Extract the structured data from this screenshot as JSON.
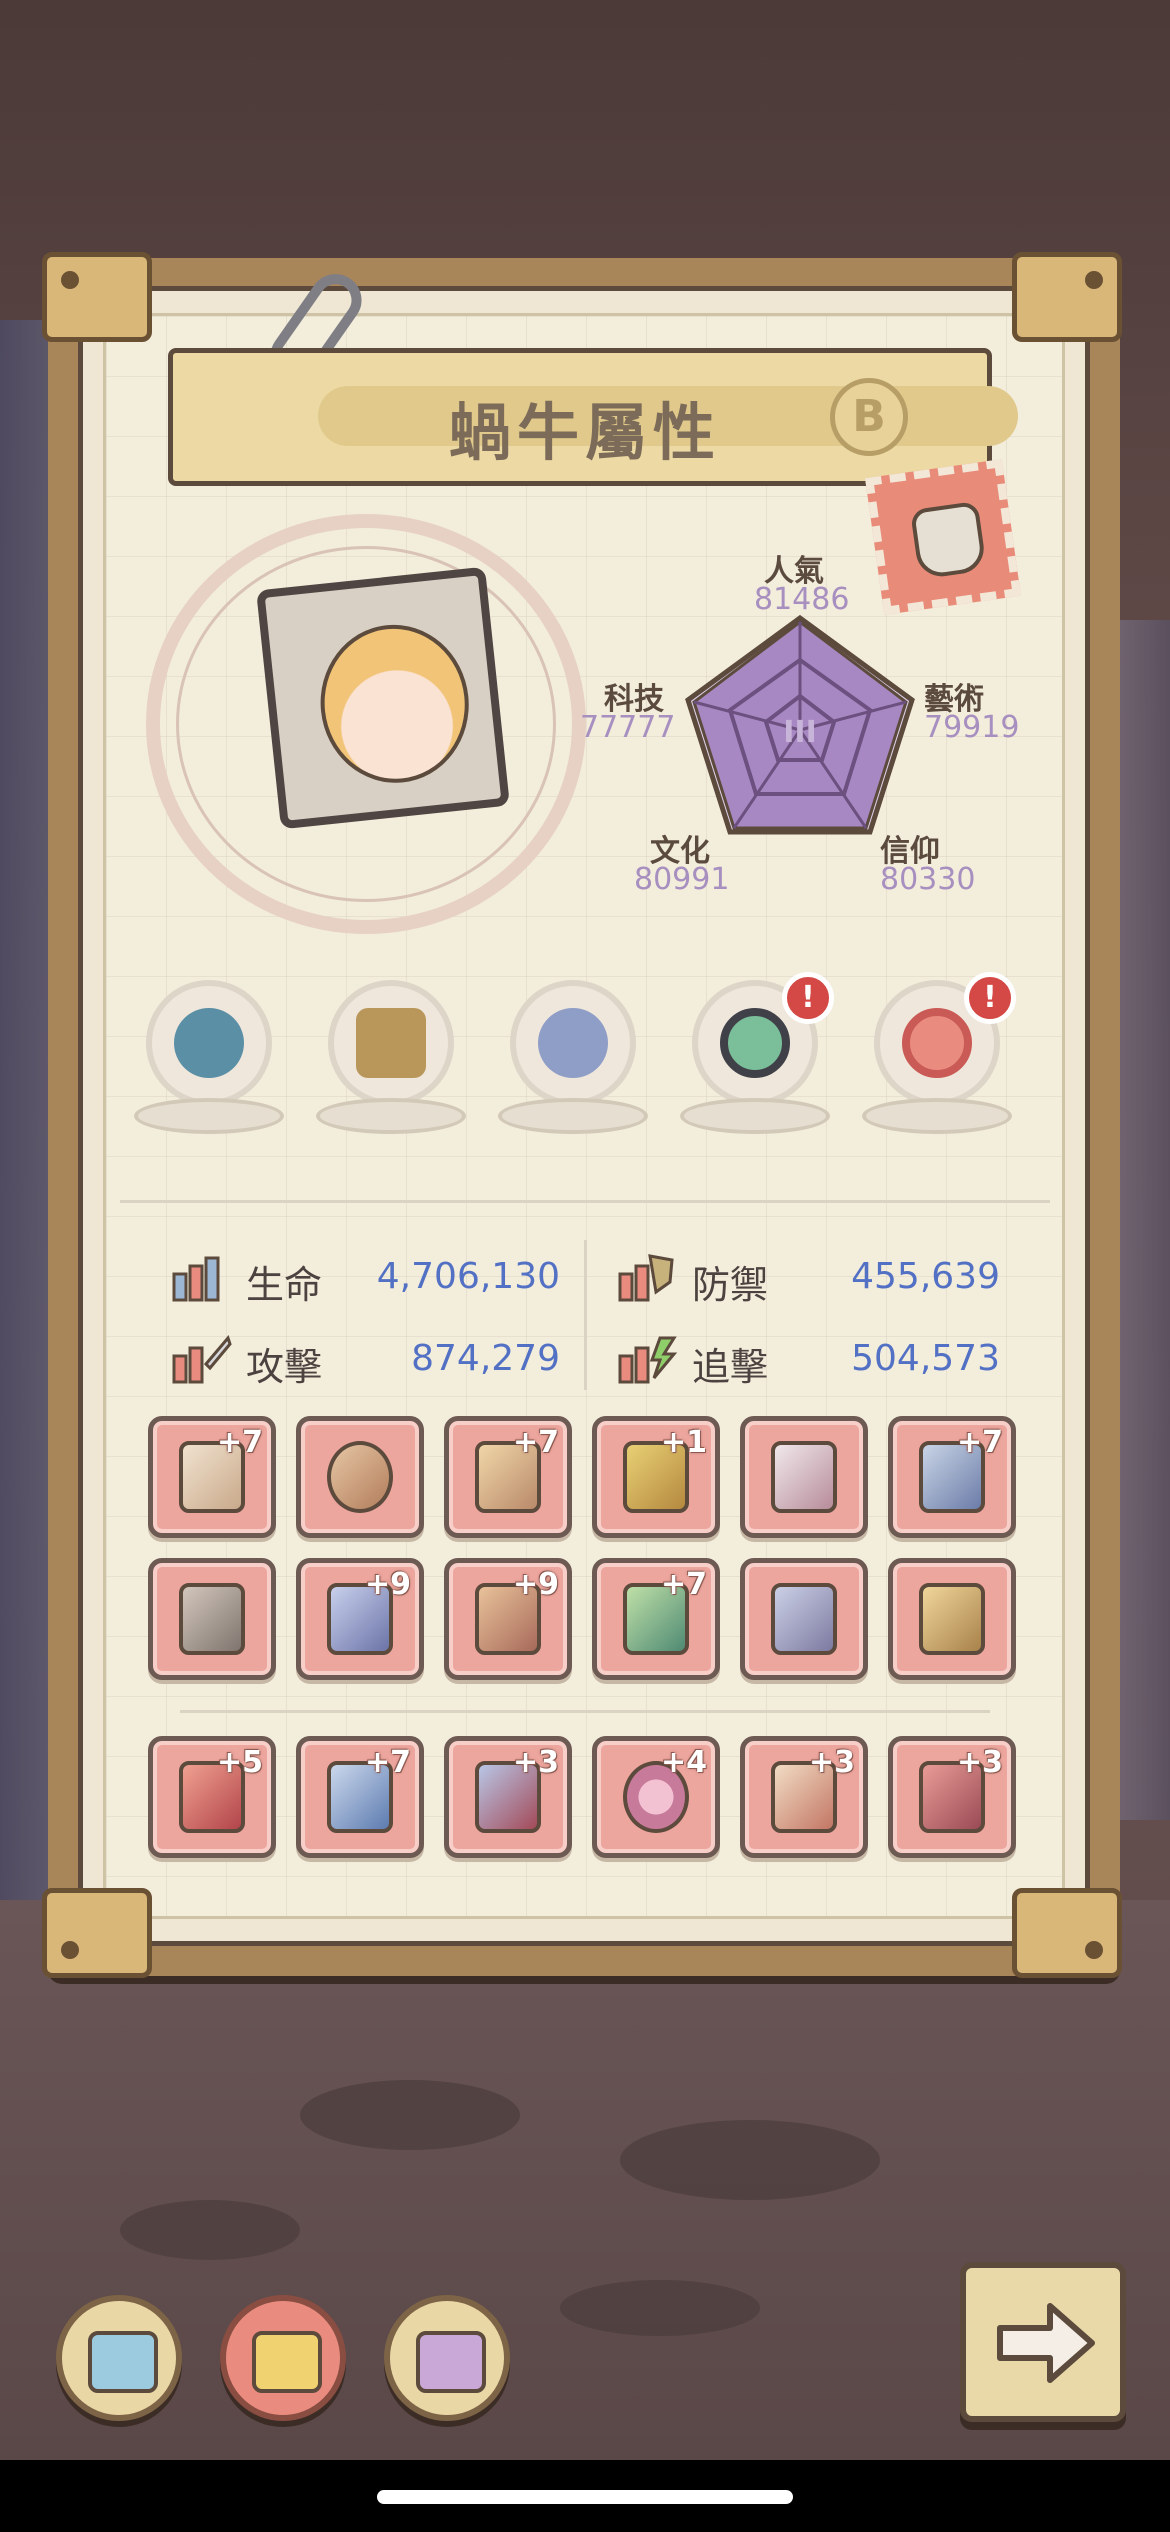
{
  "title": "蝸牛屬性",
  "rank": "B",
  "radar": {
    "center_label": "III",
    "stats": [
      {
        "name": "人氣",
        "value": "81486"
      },
      {
        "name": "藝術",
        "value": "79919"
      },
      {
        "name": "信仰",
        "value": "80330"
      },
      {
        "name": "文化",
        "value": "80991"
      },
      {
        "name": "科技",
        "value": "77777"
      }
    ]
  },
  "relics": [
    {
      "icon": "fish-skeleton-icon",
      "alert": ""
    },
    {
      "icon": "treasure-chest-icon",
      "alert": ""
    },
    {
      "icon": "compass-icon",
      "alert": ""
    },
    {
      "icon": "green-swirl-orb-icon",
      "alert": "!"
    },
    {
      "icon": "red-swirl-orb-icon",
      "alert": "!"
    }
  ],
  "combat": {
    "hp": {
      "label": "生命",
      "value": "4,706,130"
    },
    "def": {
      "label": "防禦",
      "value": "455,639"
    },
    "atk": {
      "label": "攻擊",
      "value": "874,279"
    },
    "chase": {
      "label": "追擊",
      "value": "504,573"
    }
  },
  "equipment": {
    "row1": [
      {
        "icon": "pants-icon",
        "plus": "+7"
      },
      {
        "icon": "ring-icon",
        "plus": ""
      },
      {
        "icon": "dna-staff-icon",
        "plus": "+7"
      },
      {
        "icon": "mace-icon",
        "plus": "+1"
      },
      {
        "icon": "robe-icon",
        "plus": ""
      },
      {
        "icon": "sword-icon",
        "plus": "+7"
      }
    ],
    "row2": [
      {
        "icon": "robot-armor-icon",
        "plus": ""
      },
      {
        "icon": "slingshot-icon",
        "plus": "+9"
      },
      {
        "icon": "rocket-blade-icon",
        "plus": "+9"
      },
      {
        "icon": "dragon-staff-icon",
        "plus": "+7"
      },
      {
        "icon": "crystal-rock-icon",
        "plus": ""
      },
      {
        "icon": "skull-scepter-icon",
        "plus": ""
      }
    ],
    "row3": [
      {
        "icon": "red-boot-icon",
        "plus": "+5"
      },
      {
        "icon": "gauntlet-icon",
        "plus": "+7"
      },
      {
        "icon": "helmet-icon",
        "plus": "+3"
      },
      {
        "icon": "flower-shield-icon",
        "plus": "+4"
      },
      {
        "icon": "spear-icon",
        "plus": "+3"
      },
      {
        "icon": "mech-armor-icon",
        "plus": "+3"
      }
    ]
  },
  "bottom_tabs": [
    {
      "icon": "blue-chip-icon",
      "active": false
    },
    {
      "icon": "yellow-chip-icon",
      "active": true
    },
    {
      "icon": "purple-chip-icon",
      "active": false
    }
  ],
  "colors": {
    "accent_value": "#5371c4",
    "radar_value": "#a78fc0",
    "slot": "#eda69e",
    "alert": "#d44945"
  }
}
